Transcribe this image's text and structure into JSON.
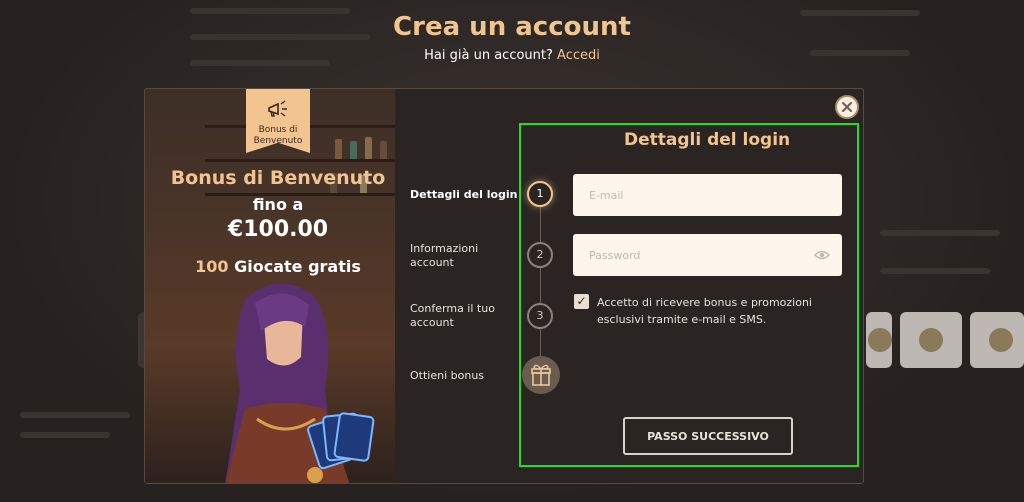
{
  "colors": {
    "accent": "#f2c48f",
    "highlight_border": "#22e01e",
    "modal_bg": "#2a2523",
    "input_bg": "#fdf6ec"
  },
  "header": {
    "title": "Crea un account",
    "subtitle": "Hai già un account?",
    "login_link": "Accedi"
  },
  "hero": {
    "ribbon_label": "Bonus di Benvenuto",
    "ribbon_icon": "megaphone-icon",
    "title": "Bonus di Benvenuto",
    "line": "fino a",
    "amount": "€100.00",
    "spins_count": "100",
    "spins_label": "Giocate gratis"
  },
  "steps": [
    {
      "label": "Dettagli del login",
      "number": "1",
      "active": true
    },
    {
      "label": "Informazioni account",
      "number": "2",
      "active": false
    },
    {
      "label": "Conferma il tuo account",
      "number": "3",
      "active": false
    },
    {
      "label": "Ottieni bonus",
      "icon": "gift-icon",
      "active": false
    }
  ],
  "form": {
    "title": "Dettagli del login",
    "email_placeholder": "E-mail",
    "password_placeholder": "Password",
    "password_toggle_icon": "eye-icon",
    "consent_checked": true,
    "consent_text": "Accetto di ricevere bonus e promozioni esclusivi tramite e-mail e SMS.",
    "next_button": "PASSO SUCCESSIVO"
  },
  "close_icon": "close-icon"
}
